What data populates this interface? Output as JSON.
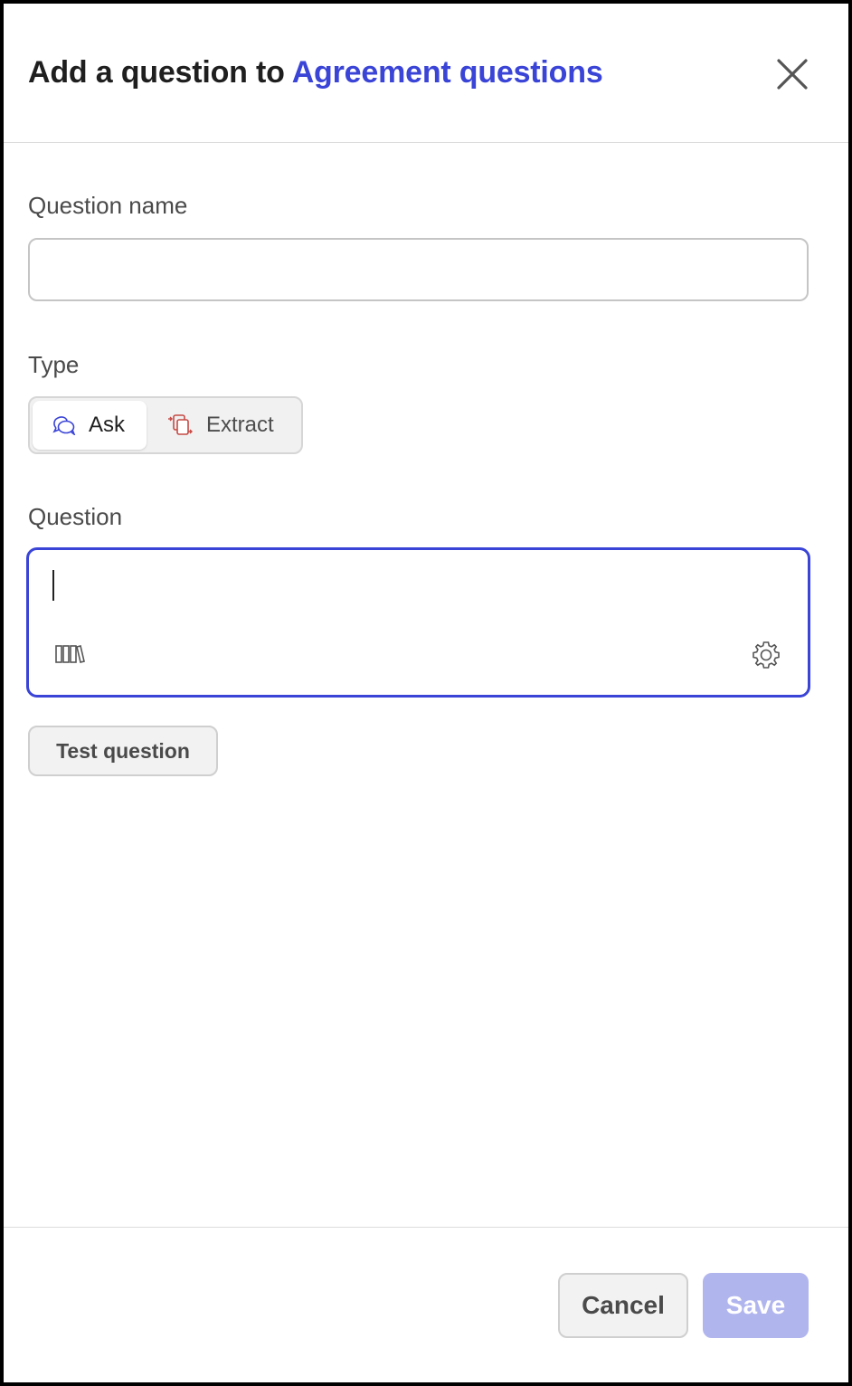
{
  "header": {
    "title_prefix": "Add a question to",
    "title_link": "Agreement questions"
  },
  "form": {
    "question_name_label": "Question name",
    "question_name_value": "",
    "type_label": "Type",
    "type_options": [
      {
        "label": "Ask",
        "icon": "chat-bubbles-icon",
        "selected": true
      },
      {
        "label": "Extract",
        "icon": "extract-document-icon",
        "selected": false
      }
    ],
    "question_label": "Question",
    "question_value": "",
    "test_button": "Test question"
  },
  "footer": {
    "cancel": "Cancel",
    "save": "Save"
  },
  "colors": {
    "accent": "#3a44d6",
    "save_disabled": "#b1b5ee",
    "extract_icon": "#c64a45"
  }
}
